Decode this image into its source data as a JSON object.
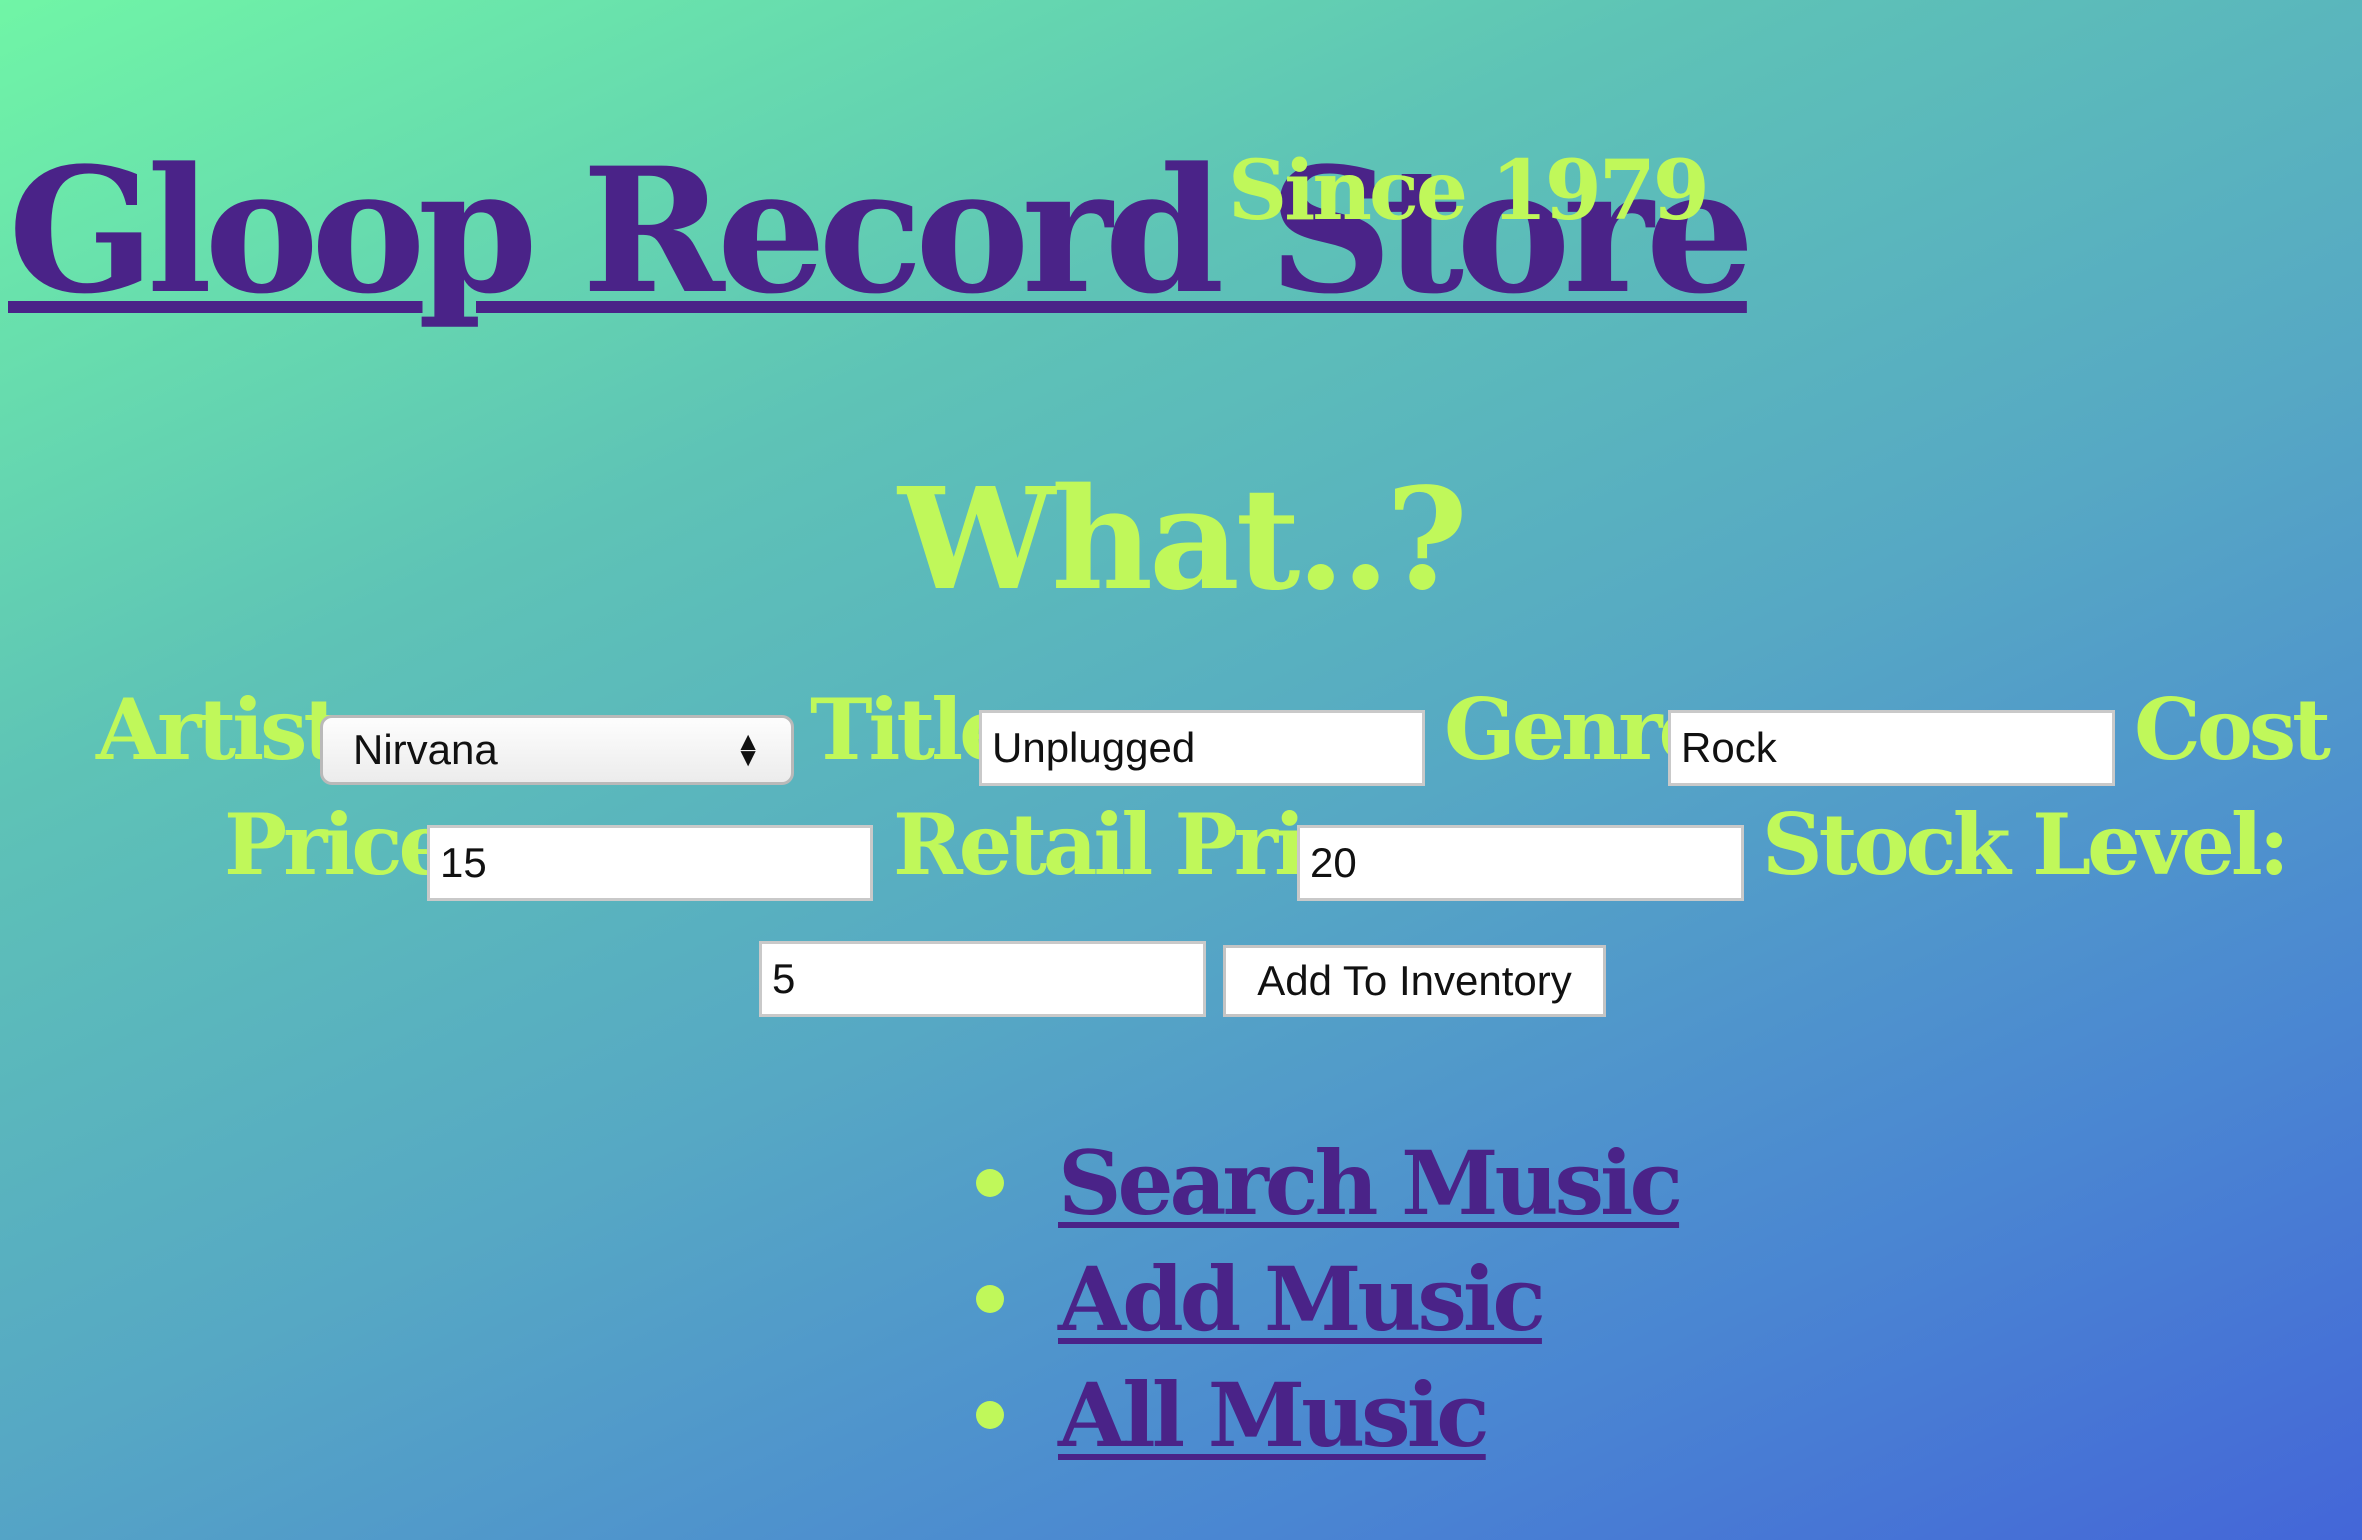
{
  "header": {
    "title": "Gloop Record Store",
    "since": "Since 1979"
  },
  "main": {
    "heading": "What..?"
  },
  "form": {
    "artist_label": "Artist:",
    "artist_value": "Nirvana",
    "title_label": "Title:",
    "title_value": "Unplugged",
    "genre_label": "Genre:",
    "genre_value": "Rock",
    "cost_label_1": "Cost",
    "cost_label_2": "Price:",
    "cost_value": "15",
    "retail_label": "Retail Price:",
    "retail_value": "20",
    "stock_label": "Stock Level:",
    "stock_value": "5",
    "submit_label": "Add To Inventory"
  },
  "nav": {
    "items": [
      {
        "label": "Search Music"
      },
      {
        "label": "Add Music"
      },
      {
        "label": "All Music"
      }
    ]
  },
  "colors": {
    "primary_purple": "#4a2388",
    "accent_lime": "#c0f85a",
    "gradient_start": "#70f5a6",
    "gradient_end": "#4466d8"
  }
}
